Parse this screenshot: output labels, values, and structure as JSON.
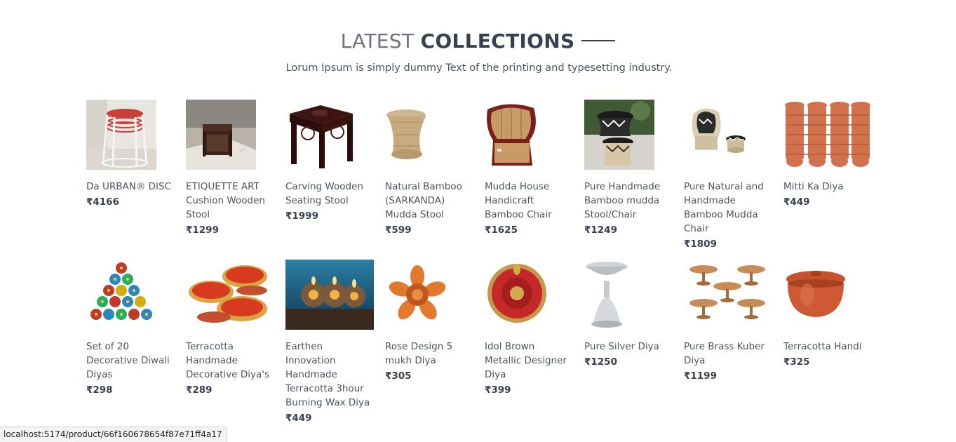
{
  "section": {
    "title_light": "LATEST",
    "title_bold": "COLLECTIONS",
    "subtitle": "Lorum Ipsum is simply dummy Text of the printing and typesetting industry."
  },
  "products": [
    {
      "name": "Da URBAN® DISC",
      "price": "₹4166",
      "image": "white-stacked-stools-image"
    },
    {
      "name": "ETIQUETTE ART Cushion Wooden Stool",
      "price": "₹1299",
      "image": "wooden-cushion-stool-image"
    },
    {
      "name": "Carving Wooden Seating Stool",
      "price": "₹1999",
      "image": "carved-wooden-stool-image"
    },
    {
      "name": "Natural Bamboo (SARKANDA) Mudda Stool",
      "price": "₹599",
      "image": "bamboo-mudda-stool-image"
    },
    {
      "name": "Mudda House Handicraft Bamboo Chair",
      "price": "₹1625",
      "image": "bamboo-chair-image"
    },
    {
      "name": "Pure Handmade Bamboo mudda Stool/Chair",
      "price": "₹1249",
      "image": "patterned-mudda-stool-image"
    },
    {
      "name": "Pure Natural and Handmade Bamboo Mudda Chair",
      "price": "₹1809",
      "image": "mudda-chair-set-image"
    },
    {
      "name": "Mitti Ka Diya",
      "price": "₹449",
      "image": "clay-diya-stack-image"
    },
    {
      "name": "Set of 20 Decorative Diwali Diyas",
      "price": "₹298",
      "image": "decorative-diyas-image"
    },
    {
      "name": "Terracotta Handmade Decorative Diya's",
      "price": "₹289",
      "image": "terracotta-diyas-image"
    },
    {
      "name": "Earthen Innovation Handmade Terracotta 3hour Burning Wax Diya",
      "price": "₹449",
      "image": "wax-diya-candles-image"
    },
    {
      "name": "Rose Design 5 mukh Diya",
      "price": "₹305",
      "image": "rose-diya-image"
    },
    {
      "name": "Idol Brown Metallic Designer Diya",
      "price": "₹399",
      "image": "metallic-designer-diya-image"
    },
    {
      "name": "Pure Silver Diya",
      "price": "₹1250",
      "image": "silver-diya-image"
    },
    {
      "name": "Pure Brass Kuber Diya",
      "price": "₹1199",
      "image": "brass-kuber-diya-image"
    },
    {
      "name": "Terracotta Handi",
      "price": "₹325",
      "image": "terracotta-handi-image"
    }
  ],
  "status_bar": {
    "url": "localhost:5174/product/66f160678654f87e71ff4a17"
  }
}
